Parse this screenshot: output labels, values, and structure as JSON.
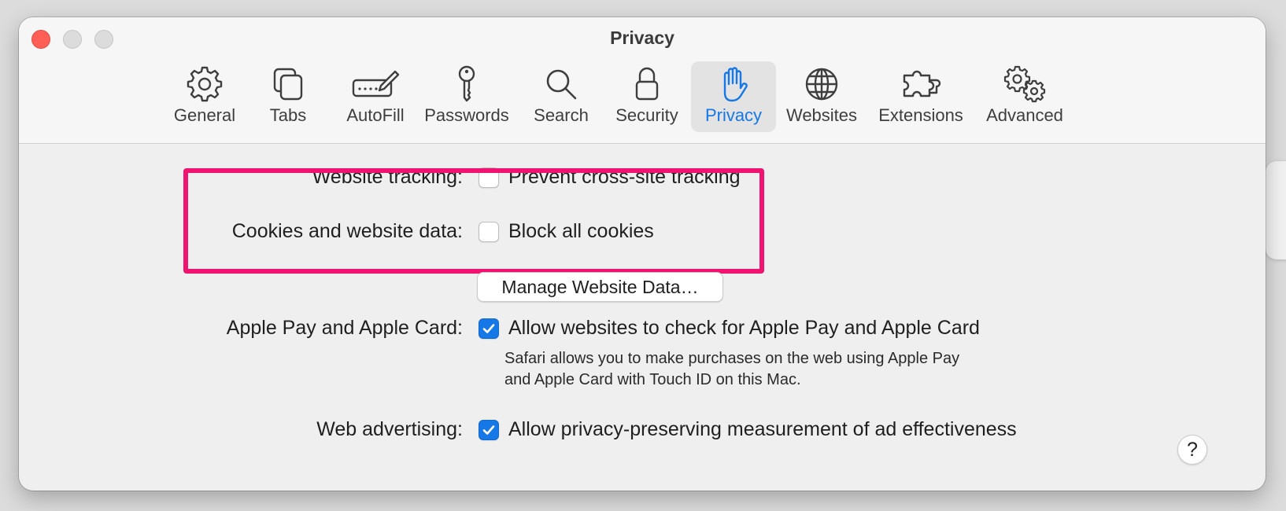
{
  "window": {
    "title": "Privacy"
  },
  "toolbar": {
    "tabs": [
      {
        "label": "General",
        "icon": "gear-icon"
      },
      {
        "label": "Tabs",
        "icon": "tabs-icon"
      },
      {
        "label": "AutoFill",
        "icon": "autofill-pencil-icon"
      },
      {
        "label": "Passwords",
        "icon": "key-icon"
      },
      {
        "label": "Search",
        "icon": "search-icon"
      },
      {
        "label": "Security",
        "icon": "lock-icon"
      },
      {
        "label": "Privacy",
        "icon": "hand-icon"
      },
      {
        "label": "Websites",
        "icon": "globe-icon"
      },
      {
        "label": "Extensions",
        "icon": "puzzle-icon"
      },
      {
        "label": "Advanced",
        "icon": "gears-icon"
      }
    ],
    "selected": "Privacy"
  },
  "privacy": {
    "website_tracking": {
      "label": "Website tracking:",
      "option": "Prevent cross-site tracking",
      "checked": false
    },
    "cookies": {
      "label": "Cookies and website data:",
      "option": "Block all cookies",
      "checked": false
    },
    "manage_button": "Manage Website Data…",
    "apple_pay": {
      "label": "Apple Pay and Apple Card:",
      "option": "Allow websites to check for Apple Pay and Apple Card",
      "checked": true,
      "description_line1": "Safari allows you to make purchases on the web using Apple Pay",
      "description_line2": "and Apple Card with Touch ID on this Mac."
    },
    "web_advertising": {
      "label": "Web advertising:",
      "option": "Allow privacy-preserving measurement of ad effectiveness",
      "checked": true
    },
    "help_label": "?"
  },
  "colors": {
    "accent": "#1677e6",
    "highlight": "#f0136f",
    "close": "#ff5f57"
  }
}
